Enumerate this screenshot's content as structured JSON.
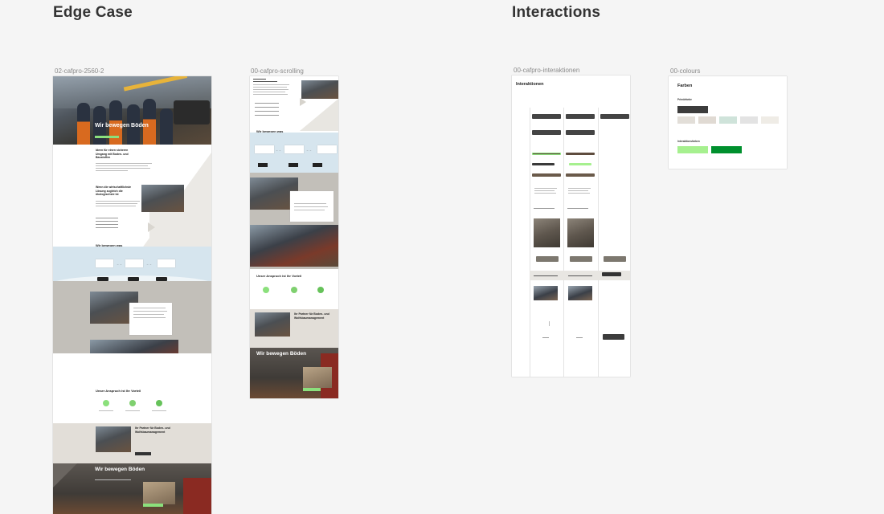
{
  "sections": {
    "edge_case": "Edge Case",
    "interactions": "Interactions"
  },
  "frames": {
    "edge": {
      "label": "02-cafpro-2560-2",
      "hero_title": "Wir bewegen Böden",
      "intro_heading": "Ideen für einen sicheren Umgang mit Boden- und Baustoffen",
      "economy_heading": "Wenn die wirtschaftlichste Lösung zugleich die ökologischste ist",
      "move_heading": "Wir bewegen was",
      "claim_heading": "Unser Anspruch ist Ihr Vorteil",
      "partner_heading": "Ihr Partner für Boden- und Wolfsbaumanagement",
      "footer_title": "Wir bewegen Böden"
    },
    "scrolling": {
      "label": "00-cafpro-scrolling",
      "move_heading": "Wir bewegen was",
      "claim_heading": "Unser Anspruch ist Ihr Vorteil",
      "partner_heading": "Ihr Partner für Boden- und Wolfsbaumanagement",
      "footer_title": "Wir bewegen Böden"
    },
    "interactions": {
      "label": "00-cafpro-interaktionen",
      "title": "Interaktionen"
    },
    "colours": {
      "label": "00-colours",
      "title": "Farben",
      "primary_label": "Primärfarbe",
      "interaction_label": "Interaktionsfarben",
      "primary": "#3c3c3c",
      "secondary": [
        "#e2ded8",
        "#e0dad3",
        "#cfe3da",
        "#e3e3e3",
        "#efece6"
      ],
      "interaction": [
        "#a6f08f",
        "#00902e"
      ]
    }
  }
}
